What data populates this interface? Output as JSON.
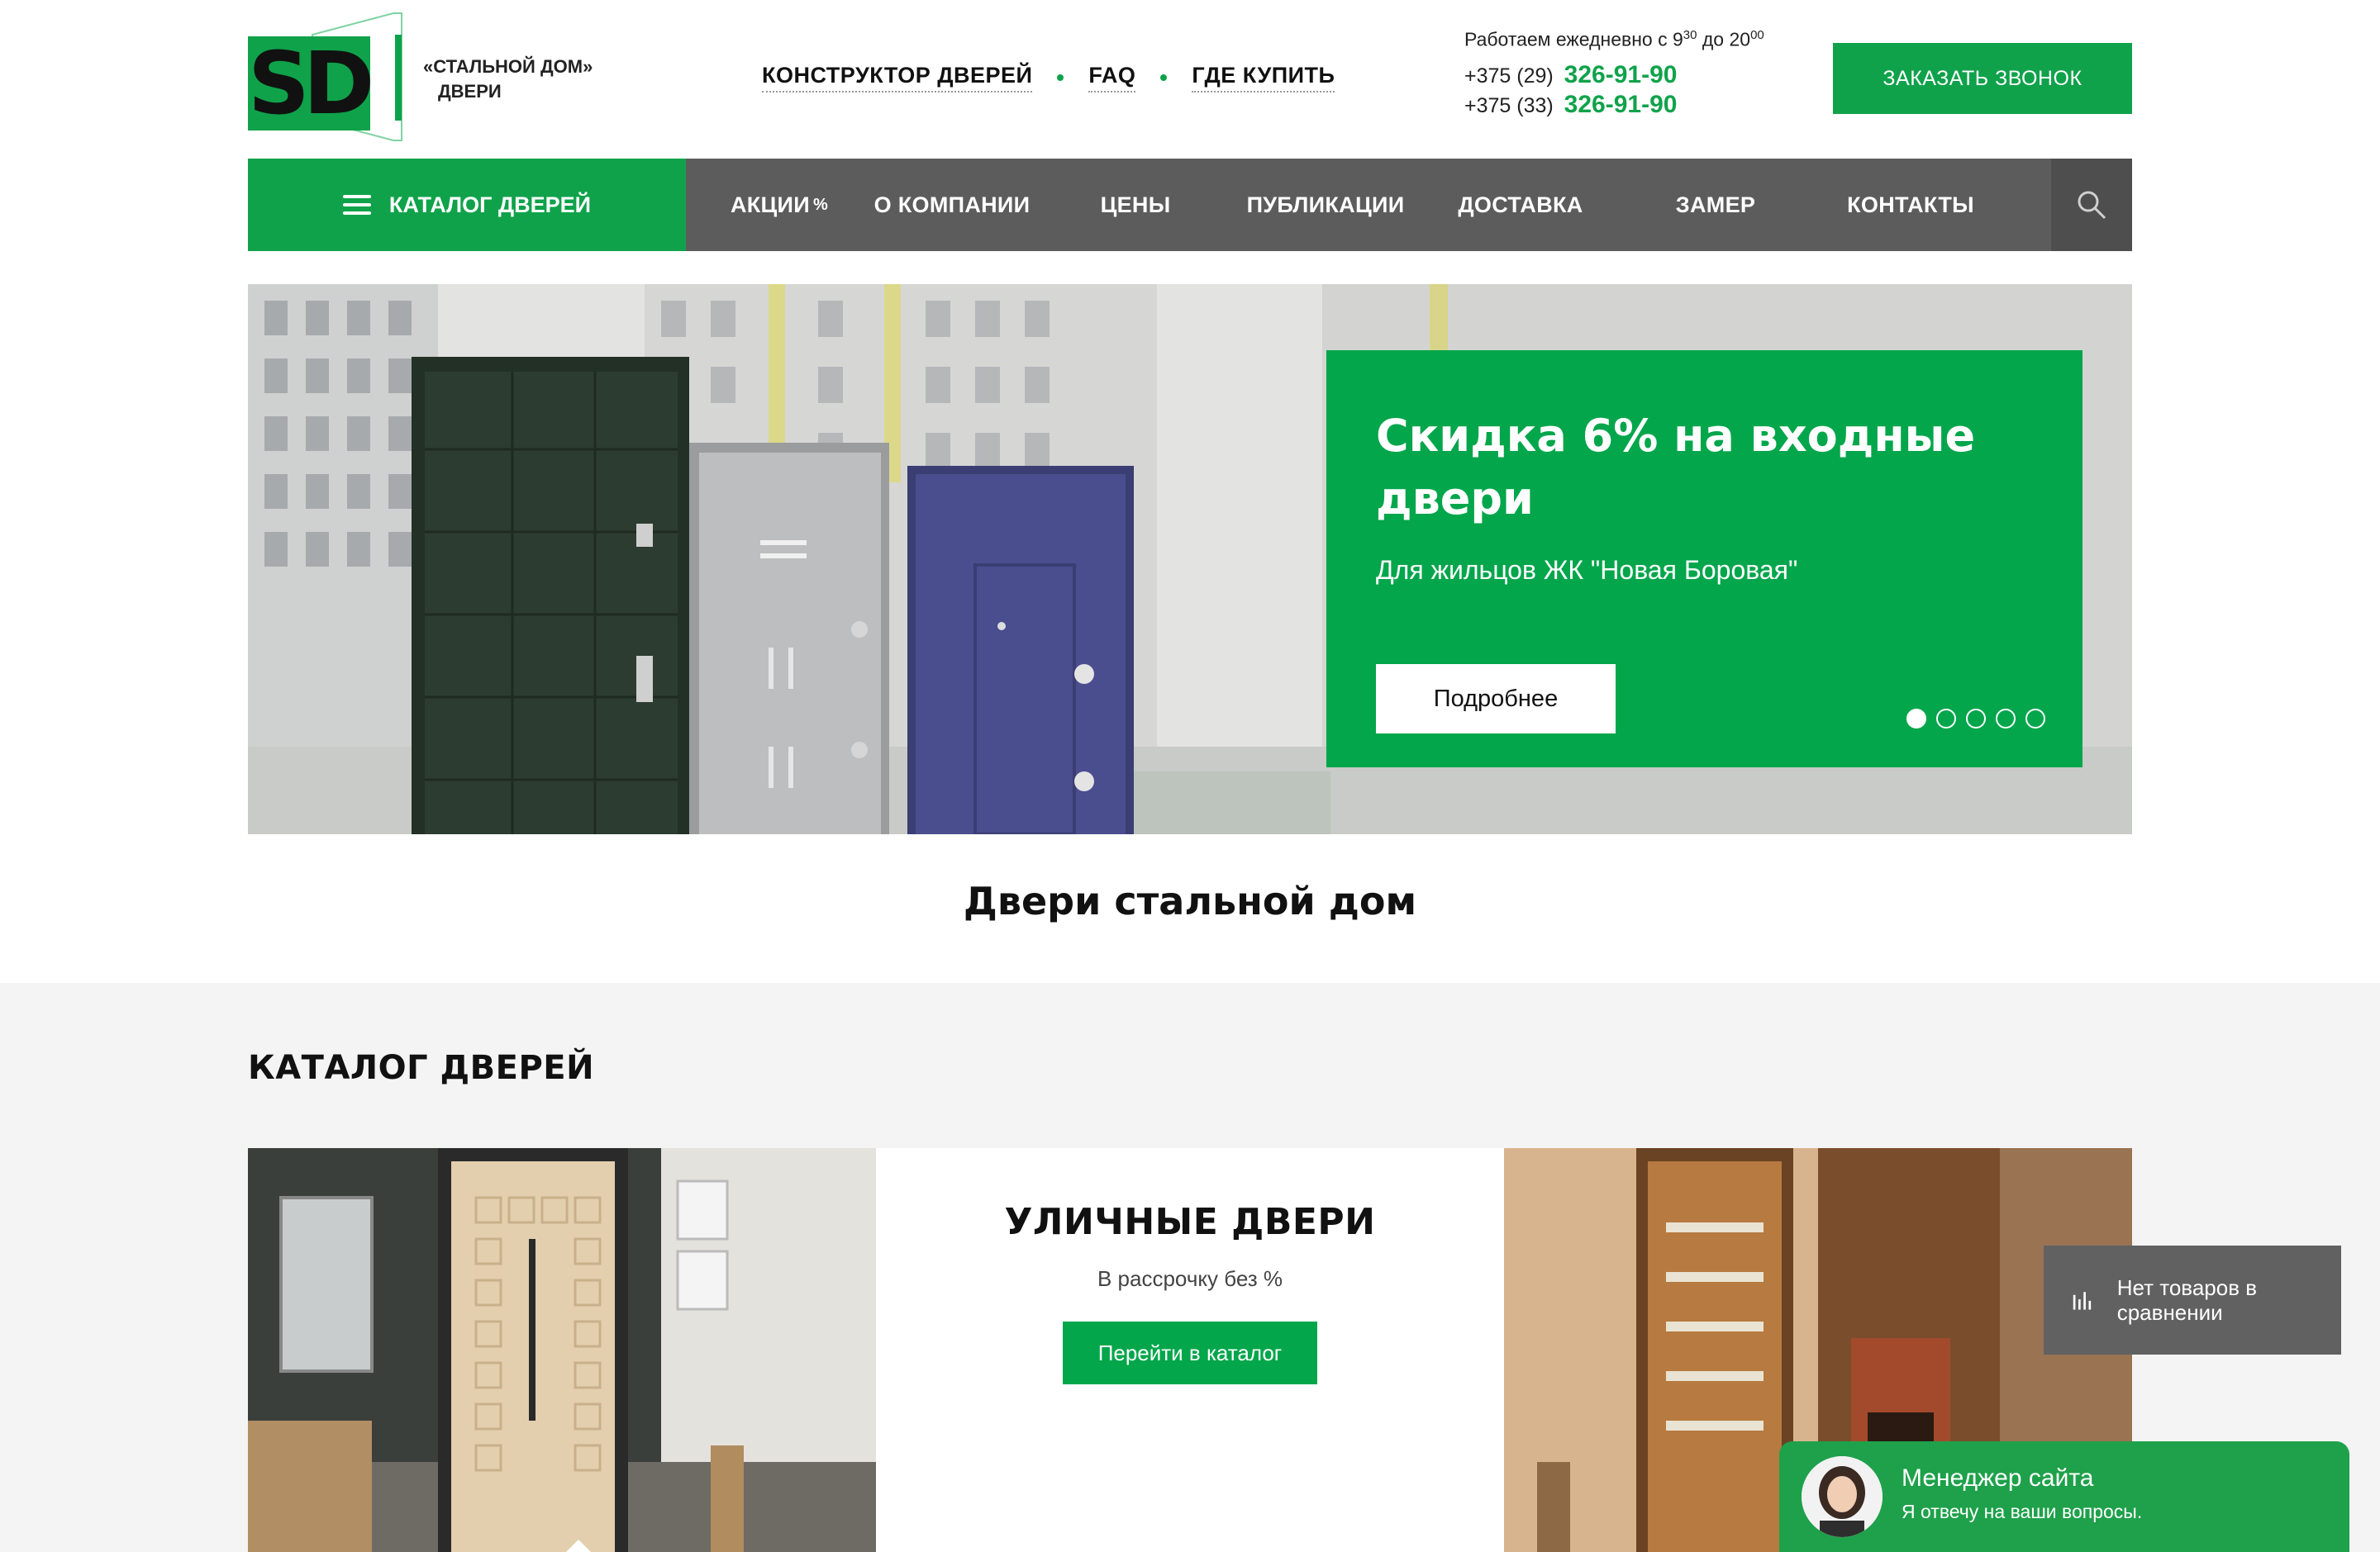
{
  "header": {
    "logo_text": "«СТАЛЬНОЙ ДОМ»",
    "logo_subtext": "ДВЕРИ",
    "logo_letters": "SD",
    "links": [
      "КОНСТРУКТОР ДВЕРЕЙ",
      "FAQ",
      "ГДЕ КУПИТЬ"
    ],
    "hours_prefix": "Работаем ежедневно с 9",
    "hours_from_min": "30",
    "hours_mid": " до 20",
    "hours_to_min": "00",
    "phones": [
      {
        "code": "+375 (29)",
        "number": "326-91-90"
      },
      {
        "code": "+375 (33)",
        "number": "326-91-90"
      }
    ],
    "call_button": "ЗАКАЗАТЬ ЗВОНОК"
  },
  "nav": {
    "catalog": "КАТАЛОГ ДВЕРЕЙ",
    "items": [
      "АКЦИИ",
      "О КОМПАНИИ",
      "ЦЕНЫ",
      "ПУБЛИКАЦИИ",
      "ДОСТАВКА",
      "ЗАМЕР",
      "КОНТАКТЫ"
    ],
    "promo_mark": "%"
  },
  "hero": {
    "title": "Скидка 6% на входные двери",
    "subtitle": "Для жильцов ЖК \"Новая Боровая\"",
    "button": "Подробнее",
    "slides_total": 5,
    "active_slide": 1
  },
  "intro_title": "Двери стальной дом",
  "catalog": {
    "title": "КАТАЛОГ ДВЕРЕЙ",
    "tile": {
      "title": "УЛИЧНЫЕ ДВЕРИ",
      "subtitle": "В рассрочку без %",
      "button": "Перейти в каталог"
    }
  },
  "compare": {
    "text": "Нет товаров в сравнении"
  },
  "chat": {
    "title": "Менеджер сайта",
    "subtitle": "Я отвечу на ваши вопросы."
  },
  "colors": {
    "brand_green": "#0fa24a",
    "nav_gray": "#5c5c5c"
  }
}
